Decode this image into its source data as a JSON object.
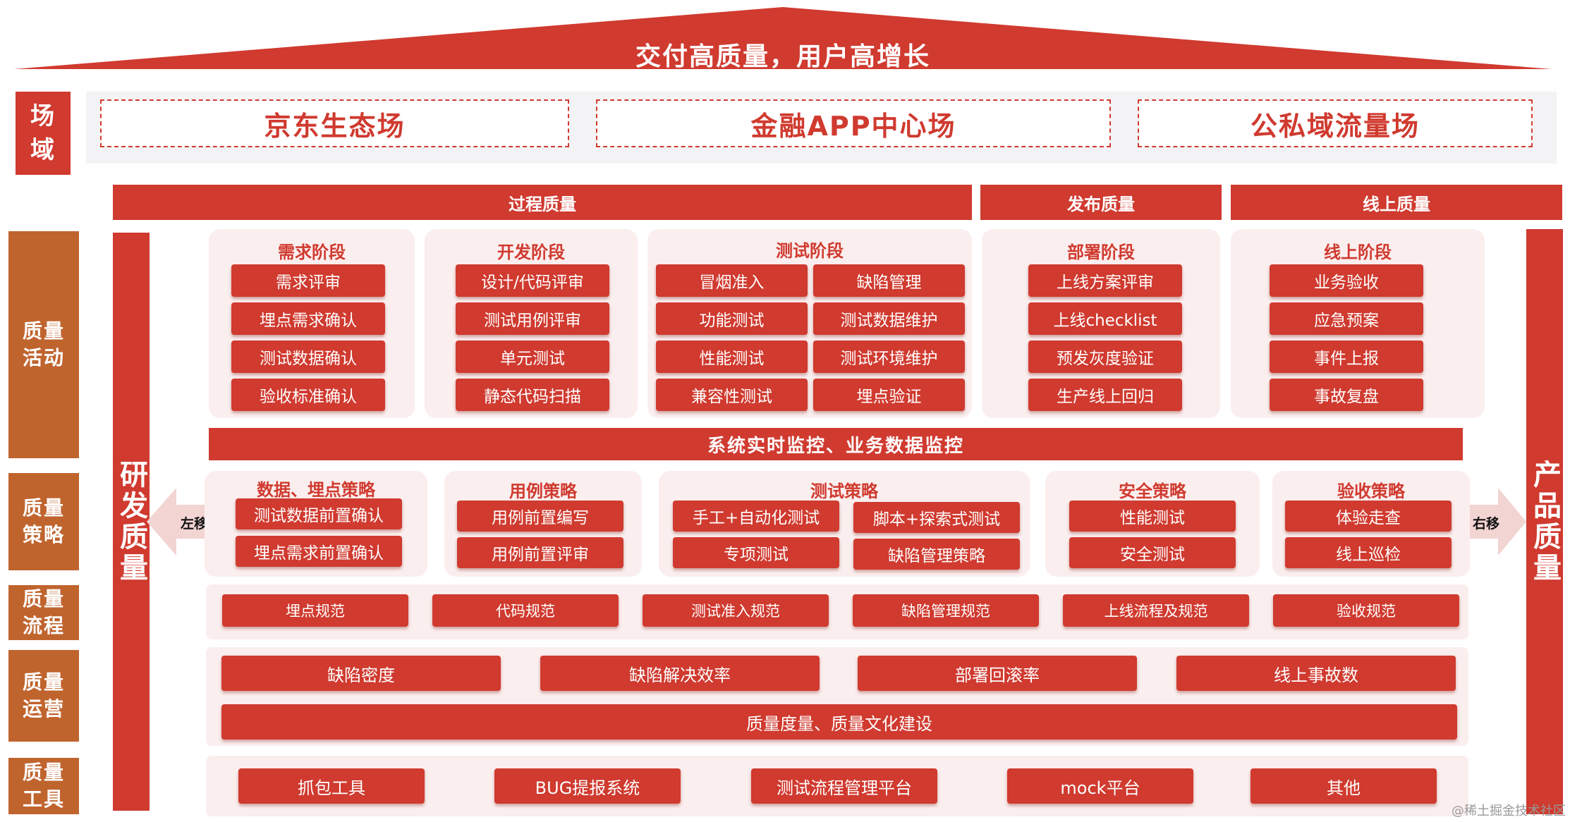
{
  "roof": {
    "title": "交付高质量，用户高增长"
  },
  "scene_label": "场\n域",
  "scenes": [
    "京东生态场",
    "金融APP中心场",
    "公私域流量场"
  ],
  "categories": {
    "quality_activity": "质量\n活动",
    "quality_strategy": "质量\n策略",
    "quality_process": "质量\n流程",
    "quality_operation": "质量\n运营",
    "quality_tools": "质量\n工具"
  },
  "headers": {
    "process": "过程质量",
    "release": "发布质量",
    "online": "线上质量"
  },
  "pillars": {
    "left": "研发质量",
    "right": "产品质量"
  },
  "stages": [
    {
      "title": "需求阶段",
      "items": [
        "需求评审",
        "埋点需求确认",
        "测试数据确认",
        "验收标准确认"
      ]
    },
    {
      "title": "开发阶段",
      "items": [
        "设计/代码评审",
        "测试用例评审",
        "单元测试",
        "静态代码扫描"
      ]
    },
    {
      "title": "测试阶段",
      "items": [
        "冒烟准入",
        "缺陷管理",
        "功能测试",
        "测试数据维护",
        "性能测试",
        "测试环境维护",
        "兼容性测试",
        "埋点验证"
      ]
    },
    {
      "title": "部署阶段",
      "items": [
        "上线方案评审",
        "上线checklist",
        "预发灰度验证",
        "生产线上回归"
      ]
    },
    {
      "title": "线上阶段",
      "items": [
        "业务验收",
        "应急预案",
        "事件上报",
        "事故复盘"
      ]
    }
  ],
  "monitor_bar": "系统实时监控、业务数据监控",
  "arrows": {
    "left": "左移",
    "right": "右移"
  },
  "strategies": [
    {
      "title": "数据、埋点策略",
      "items": [
        "测试数据前置确认",
        "埋点需求前置确认"
      ]
    },
    {
      "title": "用例策略",
      "items": [
        "用例前置编写",
        "用例前置评审"
      ]
    },
    {
      "title": "测试策略",
      "items": [
        "手工+自动化测试",
        "脚本+探索式测试",
        "专项测试",
        "缺陷管理策略"
      ]
    },
    {
      "title": "安全策略",
      "items": [
        "性能测试",
        "安全测试"
      ]
    },
    {
      "title": "验收策略",
      "items": [
        "体验走查",
        "线上巡检"
      ]
    }
  ],
  "processes": [
    "埋点规范",
    "代码规范",
    "测试准入规范",
    "缺陷管理规范",
    "上线流程及规范",
    "验收规范"
  ],
  "operations": [
    "缺陷密度",
    "缺陷解决效率",
    "部署回滚率",
    "线上事故数"
  ],
  "culture_bar": "质量度量、质量文化建设",
  "tools": [
    "抓包工具",
    "BUG提报系统",
    "测试流程管理平台",
    "mock平台",
    "其他"
  ],
  "watermark": "@稀土掘金技术社区",
  "colors": {
    "red": "#d03a2f",
    "orange": "#c0642e",
    "panel": "#fbeeee"
  }
}
